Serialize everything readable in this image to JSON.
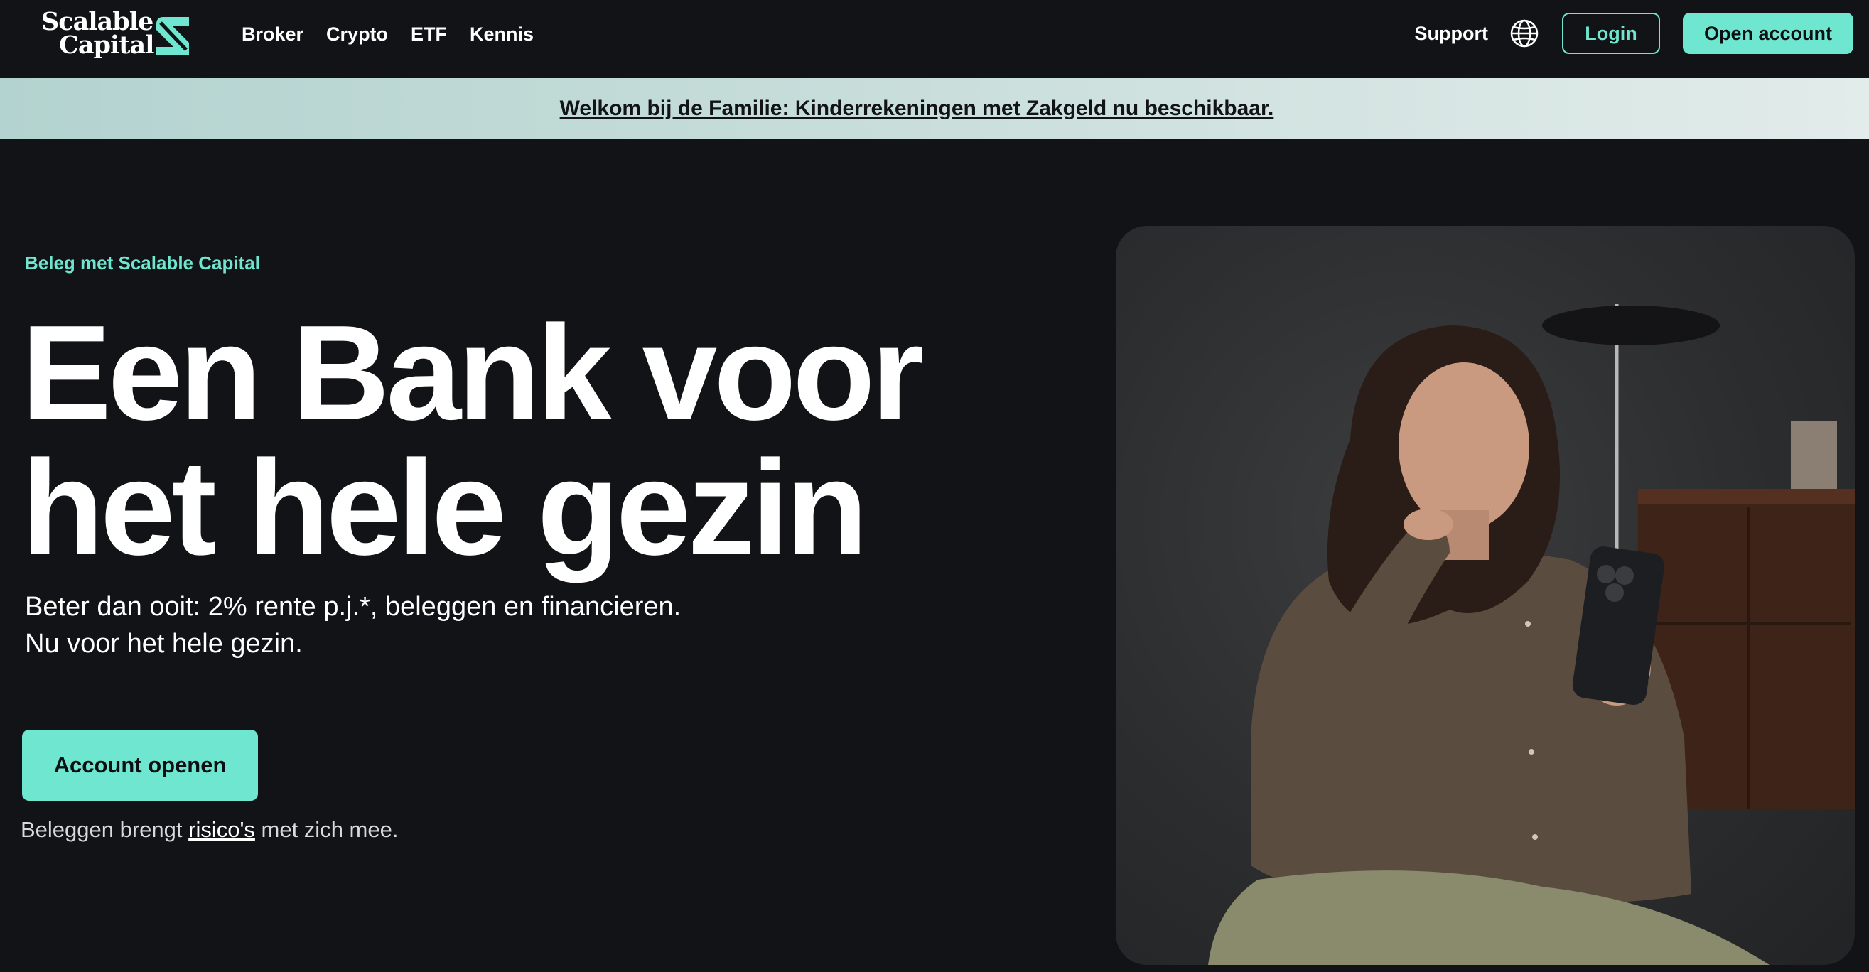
{
  "brand": {
    "logo_line1": "Scalable",
    "logo_line2": "Capital",
    "accent_color": "#6fe6cf",
    "background_color": "#111316"
  },
  "nav": {
    "links": [
      "Broker",
      "Crypto",
      "ETF",
      "Kennis"
    ],
    "support_label": "Support",
    "language_icon": "globe-icon",
    "login_label": "Login",
    "open_account_label": "Open account"
  },
  "banner": {
    "text": "Welkom bij de Familie: Kinderrekeningen met Zakgeld nu beschikbaar."
  },
  "hero": {
    "eyebrow": "Beleg met Scalable Capital",
    "title_line1": "Een Bank voor",
    "title_line2": "het hele gezin",
    "subtitle_line1": "Beter dan ooit: 2% rente p.j.*, beleggen en financieren.",
    "subtitle_line2": "Nu voor het hele gezin.",
    "cta_label": "Account openen",
    "risk_prefix": "Beleggen brengt ",
    "risk_link": "risico's",
    "risk_suffix": " met zich mee."
  }
}
